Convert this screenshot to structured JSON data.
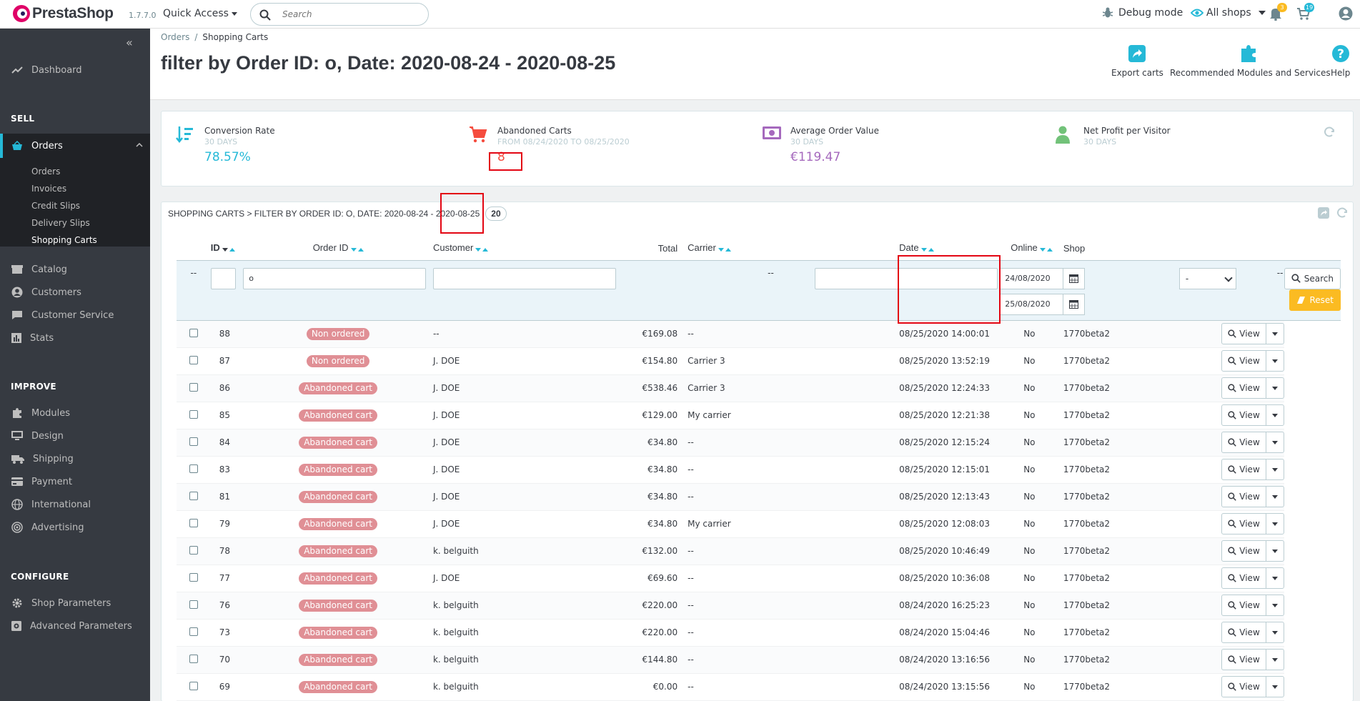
{
  "header": {
    "brand": "PrestaShop",
    "version": "1.7.7.0",
    "quick_access": "Quick Access",
    "search_placeholder": "Search",
    "debug_mode": "Debug mode",
    "shops": "All shops",
    "notifications_count": "3",
    "orders_count": "19"
  },
  "sidebar": {
    "dashboard": "Dashboard",
    "sell_title": "SELL",
    "orders": "Orders",
    "orders_sub": [
      "Orders",
      "Invoices",
      "Credit Slips",
      "Delivery Slips",
      "Shopping Carts"
    ],
    "catalog": "Catalog",
    "customers": "Customers",
    "customer_service": "Customer Service",
    "stats": "Stats",
    "improve_title": "IMPROVE",
    "modules": "Modules",
    "design": "Design",
    "shipping": "Shipping",
    "payment": "Payment",
    "international": "International",
    "advertising": "Advertising",
    "configure_title": "CONFIGURE",
    "shop_parameters": "Shop Parameters",
    "advanced_parameters": "Advanced Parameters"
  },
  "page": {
    "breadcrumb_parent": "Orders",
    "breadcrumb_current": "Shopping Carts",
    "title": "filter by Order ID: o, Date: 2020-08-24 - 2020-08-25",
    "toolbar": {
      "export": "Export carts",
      "recommended": "Recommended Modules and Services",
      "help": "Help"
    }
  },
  "kpi": [
    {
      "title": "Conversion Rate",
      "sub": "30 DAYS",
      "value": "78.57%",
      "color": "#25b9d7"
    },
    {
      "title": "Abandoned Carts",
      "sub": "FROM 08/24/2020 TO 08/25/2020",
      "value": "8",
      "color": "#f54c3e"
    },
    {
      "title": "Average Order Value",
      "sub": "30 DAYS",
      "value": "€119.47",
      "color": "#a569bd"
    },
    {
      "title": "Net Profit per Visitor",
      "sub": "30 DAYS",
      "value": "",
      "color": "#72c279"
    }
  ],
  "panel": {
    "title": "Shopping Carts > filter by Order ID: o, Date: 2020-08-24 - 2020-08-25",
    "count": "20"
  },
  "table": {
    "columns": [
      "ID",
      "Order ID",
      "Customer",
      "Total",
      "Carrier",
      "Date",
      "Online",
      "Shop"
    ],
    "filters": {
      "dash": "--",
      "order_id": "o",
      "date_from": "24/08/2020",
      "date_to": "25/08/2020",
      "online": "-",
      "search": "Search",
      "reset": "Reset"
    },
    "view_label": "View",
    "rows": [
      {
        "id": "88",
        "status": "Non ordered",
        "customer": "--",
        "total": "€169.08",
        "carrier": "--",
        "date": "08/25/2020 14:00:01",
        "online": "No",
        "shop": "1770beta2"
      },
      {
        "id": "87",
        "status": "Non ordered",
        "customer": "J. DOE",
        "total": "€154.80",
        "carrier": "Carrier 3",
        "date": "08/25/2020 13:52:19",
        "online": "No",
        "shop": "1770beta2"
      },
      {
        "id": "86",
        "status": "Abandoned cart",
        "customer": "J. DOE",
        "total": "€538.46",
        "carrier": "Carrier 3",
        "date": "08/25/2020 12:24:33",
        "online": "No",
        "shop": "1770beta2"
      },
      {
        "id": "85",
        "status": "Abandoned cart",
        "customer": "J. DOE",
        "total": "€129.00",
        "carrier": "My carrier",
        "date": "08/25/2020 12:21:38",
        "online": "No",
        "shop": "1770beta2"
      },
      {
        "id": "84",
        "status": "Abandoned cart",
        "customer": "J. DOE",
        "total": "€34.80",
        "carrier": "--",
        "date": "08/25/2020 12:15:24",
        "online": "No",
        "shop": "1770beta2"
      },
      {
        "id": "83",
        "status": "Abandoned cart",
        "customer": "J. DOE",
        "total": "€34.80",
        "carrier": "--",
        "date": "08/25/2020 12:15:01",
        "online": "No",
        "shop": "1770beta2"
      },
      {
        "id": "81",
        "status": "Abandoned cart",
        "customer": "J. DOE",
        "total": "€34.80",
        "carrier": "--",
        "date": "08/25/2020 12:13:43",
        "online": "No",
        "shop": "1770beta2"
      },
      {
        "id": "79",
        "status": "Abandoned cart",
        "customer": "J. DOE",
        "total": "€34.80",
        "carrier": "My carrier",
        "date": "08/25/2020 12:08:03",
        "online": "No",
        "shop": "1770beta2"
      },
      {
        "id": "78",
        "status": "Abandoned cart",
        "customer": "k. belguith",
        "total": "€132.00",
        "carrier": "--",
        "date": "08/25/2020 10:46:49",
        "online": "No",
        "shop": "1770beta2"
      },
      {
        "id": "77",
        "status": "Abandoned cart",
        "customer": "J. DOE",
        "total": "€69.60",
        "carrier": "--",
        "date": "08/25/2020 10:36:08",
        "online": "No",
        "shop": "1770beta2"
      },
      {
        "id": "76",
        "status": "Abandoned cart",
        "customer": "k. belguith",
        "total": "€220.00",
        "carrier": "--",
        "date": "08/24/2020 16:25:23",
        "online": "No",
        "shop": "1770beta2"
      },
      {
        "id": "73",
        "status": "Abandoned cart",
        "customer": "k. belguith",
        "total": "€220.00",
        "carrier": "--",
        "date": "08/24/2020 15:04:46",
        "online": "No",
        "shop": "1770beta2"
      },
      {
        "id": "70",
        "status": "Abandoned cart",
        "customer": "k. belguith",
        "total": "€144.80",
        "carrier": "--",
        "date": "08/24/2020 13:16:56",
        "online": "No",
        "shop": "1770beta2"
      },
      {
        "id": "69",
        "status": "Abandoned cart",
        "customer": "k. belguith",
        "total": "€0.00",
        "carrier": "--",
        "date": "08/24/2020 13:15:56",
        "online": "No",
        "shop": "1770beta2"
      }
    ]
  }
}
